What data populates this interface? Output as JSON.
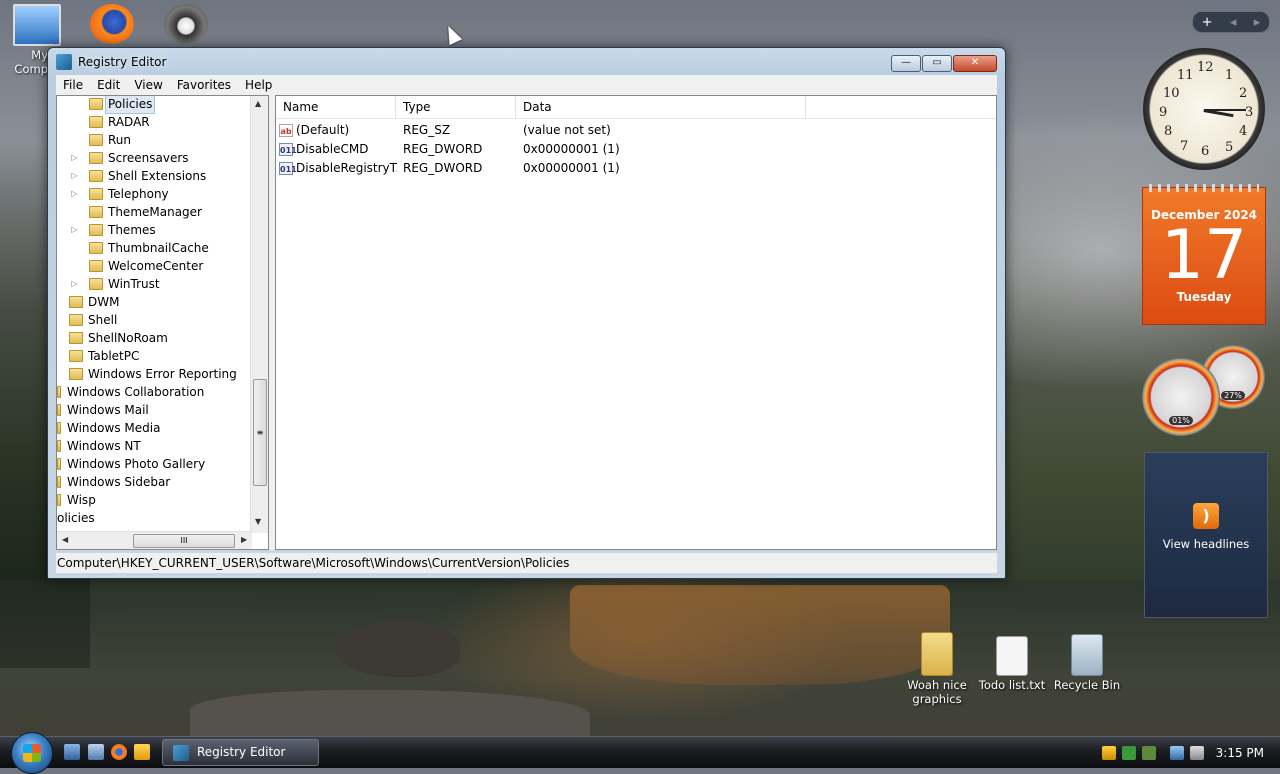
{
  "desktop": {
    "top_icons": [
      {
        "label": "My Computer",
        "visible_label": "My\nComp"
      },
      {
        "label": "",
        "name": "firefox"
      },
      {
        "label": "",
        "name": "raccoon"
      }
    ],
    "bottom_icons": [
      {
        "label": "Woah nice graphics"
      },
      {
        "label": "Todo list.txt"
      },
      {
        "label": "Recycle Bin"
      }
    ]
  },
  "gadgets": {
    "sidebar_controls": {
      "add": "+",
      "prev": "◂",
      "next": "▸"
    },
    "clock": {
      "numbers": [
        "12",
        "1",
        "2",
        "3",
        "4",
        "5",
        "6",
        "7",
        "8",
        "9",
        "10",
        "11"
      ],
      "time": "3:15"
    },
    "calendar": {
      "month": "December 2024",
      "day": "17",
      "weekday": "Tuesday"
    },
    "cpu_meter": {
      "cpu": "01%",
      "memory": "27%"
    },
    "feed": {
      "label": "View headlines"
    }
  },
  "window": {
    "title": "Registry Editor",
    "buttons": {
      "minimize": "—",
      "maximize": "▭",
      "close": "✕"
    },
    "menu": [
      "File",
      "Edit",
      "View",
      "Favorites",
      "Help"
    ],
    "tree": [
      {
        "label": "Policies",
        "level": 2,
        "expander": "",
        "selected": true
      },
      {
        "label": "RADAR",
        "level": 2,
        "expander": ""
      },
      {
        "label": "Run",
        "level": 2,
        "expander": ""
      },
      {
        "label": "Screensavers",
        "level": 2,
        "expander": "▷"
      },
      {
        "label": "Shell Extensions",
        "level": 2,
        "expander": "▷"
      },
      {
        "label": "Telephony",
        "level": 2,
        "expander": "▷"
      },
      {
        "label": "ThemeManager",
        "level": 2,
        "expander": ""
      },
      {
        "label": "Themes",
        "level": 2,
        "expander": "▷"
      },
      {
        "label": "ThumbnailCache",
        "level": 2,
        "expander": ""
      },
      {
        "label": "WelcomeCenter",
        "level": 2,
        "expander": ""
      },
      {
        "label": "WinTrust",
        "level": 2,
        "expander": "▷"
      },
      {
        "label": "DWM",
        "level": 1,
        "expander": ""
      },
      {
        "label": "Shell",
        "level": 1,
        "expander": ""
      },
      {
        "label": "ShellNoRoam",
        "level": 1,
        "expander": ""
      },
      {
        "label": "TabletPC",
        "level": 1,
        "expander": ""
      },
      {
        "label": "Windows Error Reporting",
        "level": 1,
        "expander": ""
      },
      {
        "label": "Windows Collaboration",
        "level": 0,
        "expander": ""
      },
      {
        "label": "Windows Mail",
        "level": 0,
        "expander": ""
      },
      {
        "label": "Windows Media",
        "level": 0,
        "expander": ""
      },
      {
        "label": "Windows NT",
        "level": 0,
        "expander": ""
      },
      {
        "label": "Windows Photo Gallery",
        "level": 0,
        "expander": ""
      },
      {
        "label": "Windows Sidebar",
        "level": 0,
        "expander": ""
      },
      {
        "label": "Wisp",
        "level": 0,
        "expander": ""
      },
      {
        "label": "olicies",
        "level": -1,
        "expander": ""
      }
    ],
    "scroll_glyphs": {
      "up": "▲",
      "down": "▼",
      "left": "◀",
      "right": "▶",
      "grip_v": "≡",
      "grip_h": "III"
    },
    "columns": [
      "Name",
      "Type",
      "Data"
    ],
    "values": [
      {
        "icon": "ab",
        "name": "(Default)",
        "type": "REG_SZ",
        "data": "(value not set)"
      },
      {
        "icon": "011",
        "name": "DisableCMD",
        "type": "REG_DWORD",
        "data": "0x00000001 (1)"
      },
      {
        "icon": "011",
        "name": "DisableRegistryT...",
        "type": "REG_DWORD",
        "data": "0x00000001 (1)"
      }
    ],
    "status_path": "Computer\\HKEY_CURRENT_USER\\Software\\Microsoft\\Windows\\CurrentVersion\\Policies"
  },
  "taskbar": {
    "task": "Registry Editor",
    "time": "3:15 PM"
  }
}
